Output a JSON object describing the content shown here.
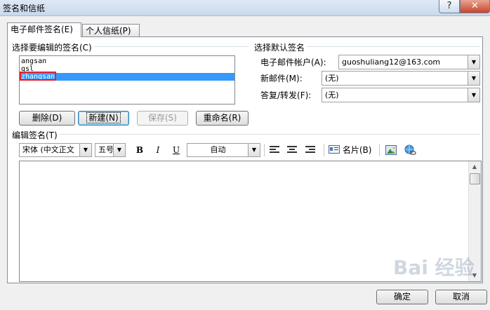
{
  "window": {
    "title": "签名和信纸",
    "help": "?",
    "close": "✕"
  },
  "tabs": [
    {
      "label": "电子邮件签名(E)"
    },
    {
      "label": "个人信纸(P)"
    }
  ],
  "signatures": {
    "group_label": "选择要编辑的签名(C)",
    "items": [
      "angsan",
      "gsl",
      "zhangsan"
    ],
    "selected_index": 2,
    "buttons": {
      "delete": "删除(D)",
      "new": "新建(N)",
      "save": "保存(S)",
      "rename": "重命名(R)"
    }
  },
  "defaults": {
    "group_label": "选择默认签名",
    "account_label": "电子邮件帐户(A):",
    "account_value": "guoshuliang12@163.com",
    "new_label": "新邮件(M):",
    "new_value": "(无)",
    "reply_label": "答复/转发(F):",
    "reply_value": "(无)"
  },
  "editor": {
    "group_label": "编辑签名(T)",
    "font": "宋体 (中文正文",
    "size": "五号",
    "bold": "B",
    "italic": "I",
    "underline": "U",
    "color": "自动",
    "card_label": "名片(B)"
  },
  "footer": {
    "ok": "确定",
    "cancel": "取消"
  },
  "watermark": "Bai 经验"
}
